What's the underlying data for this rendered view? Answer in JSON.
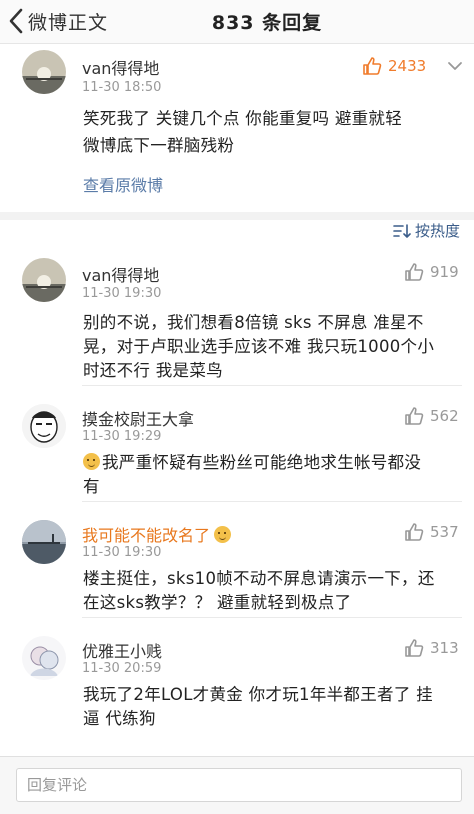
{
  "nav": {
    "back_label": "微博正文",
    "title": "833 条回复"
  },
  "original": {
    "username": "van得得地",
    "time": "11-30 18:50",
    "likes": "2433",
    "text_line1": "笑死我了 关键几个点 你能重复吗 避重就轻",
    "text_line2": "微博底下一群脑残粉",
    "view_original": "查看原微博"
  },
  "sort": {
    "label": "按热度"
  },
  "comments": [
    {
      "username": "van得得地",
      "time": "11-30 19:30",
      "likes": "919",
      "line1": "别的不说，我们想看8倍镜 sks 不屏息 准星不",
      "line2": "晃，对于卢职业选手应该不难 我只玩1000个小",
      "line3": "时还不行 我是菜鸟"
    },
    {
      "username": "摸金校尉王大拿",
      "time": "11-30 19:29",
      "likes": "562",
      "line1": "我严重怀疑有些粉丝可能绝地求生帐号都没",
      "line2": "有"
    },
    {
      "username": "我可能不能改名了",
      "time": "11-30 19:30",
      "likes": "537",
      "line1": "楼主挺住，sks10帧不动不屏息请演示一下，还",
      "line2": "在这sks教学？？ 避重就轻到极点了"
    },
    {
      "username": "优雅王小贱",
      "time": "11-30 20:59",
      "likes": "313",
      "line1": "我玩了2年LOL才黄金 你才玩1年半都王者了 挂",
      "line2": "逼 代练狗"
    }
  ],
  "reply": {
    "placeholder": "回复评论"
  },
  "colors": {
    "link": "#5b7ca8",
    "sort": "#3b5d8a",
    "like_active": "#f07c2c",
    "highlight_name": "#e8781e"
  }
}
